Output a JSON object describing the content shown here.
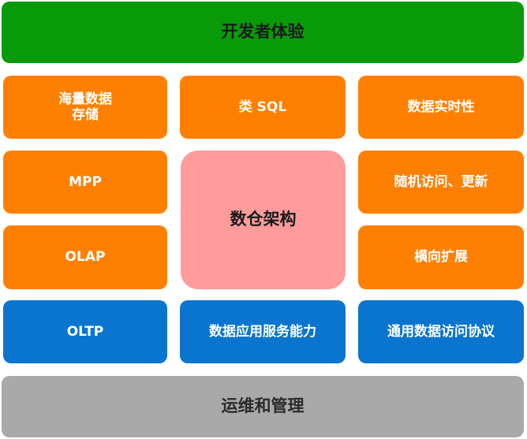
{
  "top_bar": {
    "label": "开发者体验"
  },
  "bottom_bar": {
    "label": "运维和管理"
  },
  "center": {
    "label": "数仓架构"
  },
  "row1": {
    "left": "海量数据\n存储",
    "middle": "类 SQL",
    "right": "数据实时性"
  },
  "row2": {
    "left": "MPP",
    "right": "随机访问、更新"
  },
  "row3": {
    "left": "OLAP",
    "right": "横向扩展"
  },
  "row4": {
    "left": "OLTP",
    "middle": "数据应用服务能力",
    "right": "通用数据访问协议"
  },
  "colors": {
    "green": "#089a08",
    "orange": "#ff8000",
    "pink": "#ff9b9b",
    "blue": "#0a75cf",
    "gray": "#a9a9a9"
  }
}
